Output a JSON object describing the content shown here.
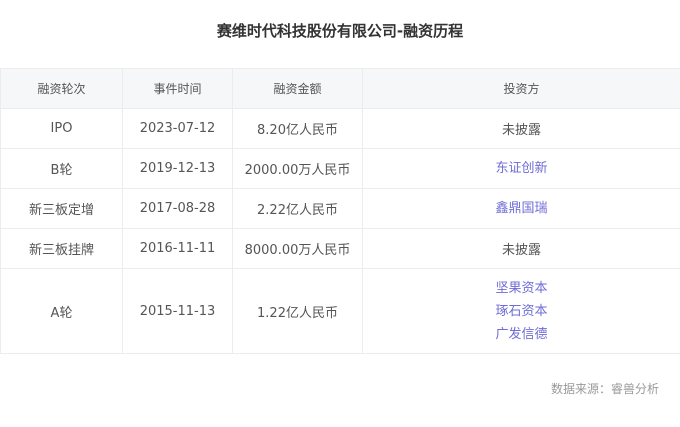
{
  "title": "赛维时代科技股份有限公司-融资历程",
  "table": {
    "headers": [
      "融资轮次",
      "事件时间",
      "融资金额",
      "投资方"
    ],
    "rows": [
      {
        "round": "IPO",
        "date": "2023-07-12",
        "amount": "8.20亿人民币",
        "investors": [
          "未披露"
        ],
        "investors_linked": false
      },
      {
        "round": "B轮",
        "date": "2019-12-13",
        "amount": "2000.00万人民币",
        "investors": [
          "东证创新"
        ],
        "investors_linked": true
      },
      {
        "round": "新三板定增",
        "date": "2017-08-28",
        "amount": "2.22亿人民币",
        "investors": [
          "鑫鼎国瑞"
        ],
        "investors_linked": true
      },
      {
        "round": "新三板挂牌",
        "date": "2016-11-11",
        "amount": "8000.00万人民币",
        "investors": [
          "未披露"
        ],
        "investors_linked": false
      },
      {
        "round": "A轮",
        "date": "2015-11-13",
        "amount": "1.22亿人民币",
        "investors": [
          "坚果资本",
          "琢石资本",
          "广发信德"
        ],
        "investors_linked": true
      }
    ]
  },
  "source": "数据来源：睿兽分析",
  "colors": {
    "link": "#6f6cd6",
    "header_bg": "#f6f7f9",
    "border": "#ececec"
  }
}
